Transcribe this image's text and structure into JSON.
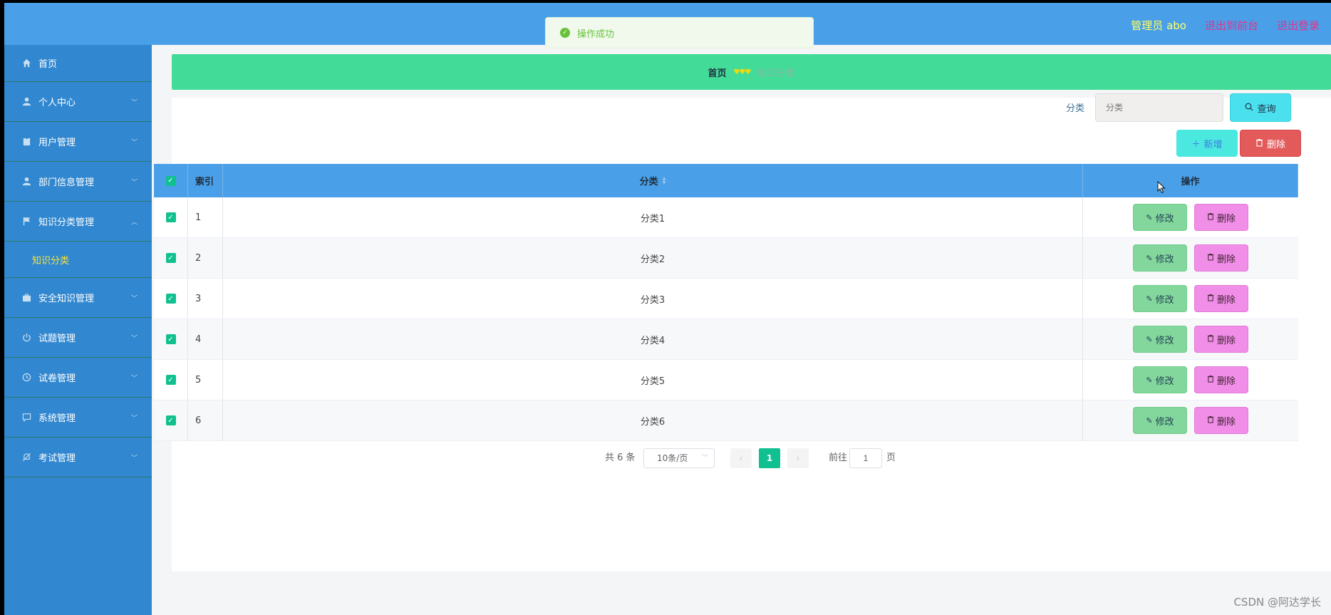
{
  "header": {
    "admin_text": "管理员 abo",
    "front_link": "退出到前台",
    "logout_link": "退出登录"
  },
  "toast": {
    "message": "操作成功"
  },
  "sidebar": {
    "items": [
      {
        "label": "首页",
        "icon": "home-icon"
      },
      {
        "label": "个人中心",
        "icon": "user-icon"
      },
      {
        "label": "用户管理",
        "icon": "clipboard-icon"
      },
      {
        "label": "部门信息管理",
        "icon": "user-icon"
      },
      {
        "label": "知识分类管理",
        "icon": "flag-icon"
      },
      {
        "label": "安全知识管理",
        "icon": "briefcase-icon"
      },
      {
        "label": "试题管理",
        "icon": "power-icon"
      },
      {
        "label": "试卷管理",
        "icon": "clock-icon"
      },
      {
        "label": "系统管理",
        "icon": "chat-icon"
      },
      {
        "label": "考试管理",
        "icon": "bell-off-icon"
      }
    ],
    "submenu": {
      "label": "知识分类"
    }
  },
  "breadcrumb": {
    "home": "首页",
    "separator": "♥♥♥",
    "current": "知识分类"
  },
  "search": {
    "label": "分类",
    "placeholder": "分类",
    "query_button": "查询"
  },
  "actions": {
    "add_button": "新增",
    "delete_button": "删除"
  },
  "table": {
    "headers": {
      "index": "索引",
      "category": "分类",
      "operation": "操作"
    },
    "rows": [
      {
        "index": "1",
        "category": "分类1"
      },
      {
        "index": "2",
        "category": "分类2"
      },
      {
        "index": "3",
        "category": "分类3"
      },
      {
        "index": "4",
        "category": "分类4"
      },
      {
        "index": "5",
        "category": "分类5"
      },
      {
        "index": "6",
        "category": "分类6"
      }
    ],
    "edit_label": "修改",
    "delete_label": "删除"
  },
  "pagination": {
    "total": "共 6 条",
    "page_size": "10条/页",
    "current_page": "1",
    "goto_label": "前往",
    "goto_value": "1",
    "page_unit": "页"
  },
  "watermark": "CSDN @阿达学长",
  "colors": {
    "topbar": "#4aa0e8",
    "sidebar": "#3288d0",
    "breadcrumb": "#42dc98",
    "accent": "#11c08f"
  }
}
